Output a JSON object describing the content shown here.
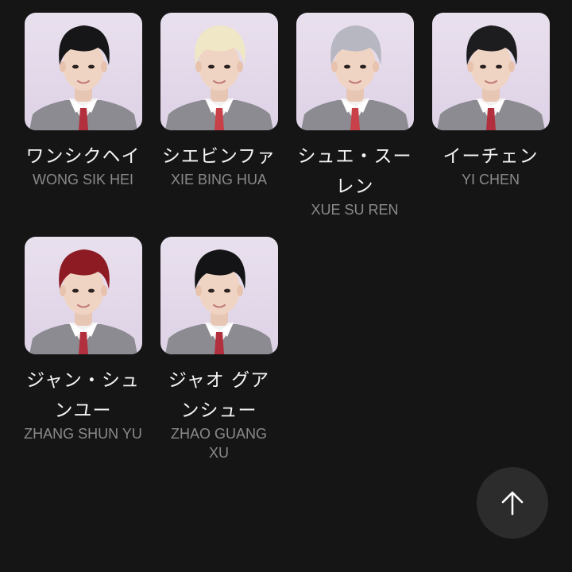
{
  "trainees": [
    {
      "jp": "ワンシクヘイ",
      "en": "WONG SIK HEI",
      "hair": "#161618",
      "tie": "#b2303d"
    },
    {
      "jp": "シエビンファ",
      "en": "XIE BING HUA",
      "hair": "#efe7c6",
      "tie": "#c84048"
    },
    {
      "jp": "シュエ・スーレン",
      "en": "XUE SU REN",
      "hair": "#b7b7c2",
      "tie": "#c84048"
    },
    {
      "jp": "イーチェン",
      "en": "YI CHEN",
      "hair": "#1d1d20",
      "tie": "#b2303d"
    },
    {
      "jp": "ジャン・シュンユー",
      "en": "ZHANG SHUN YU",
      "hair": "#8d1b24",
      "tie": "#b2303d"
    },
    {
      "jp": "ジャオ グアンシュー",
      "en": "ZHAO GUANG XU",
      "hair": "#141416",
      "tie": "#b2303d"
    }
  ],
  "scroll_top": {
    "icon": "arrow-up-icon"
  }
}
